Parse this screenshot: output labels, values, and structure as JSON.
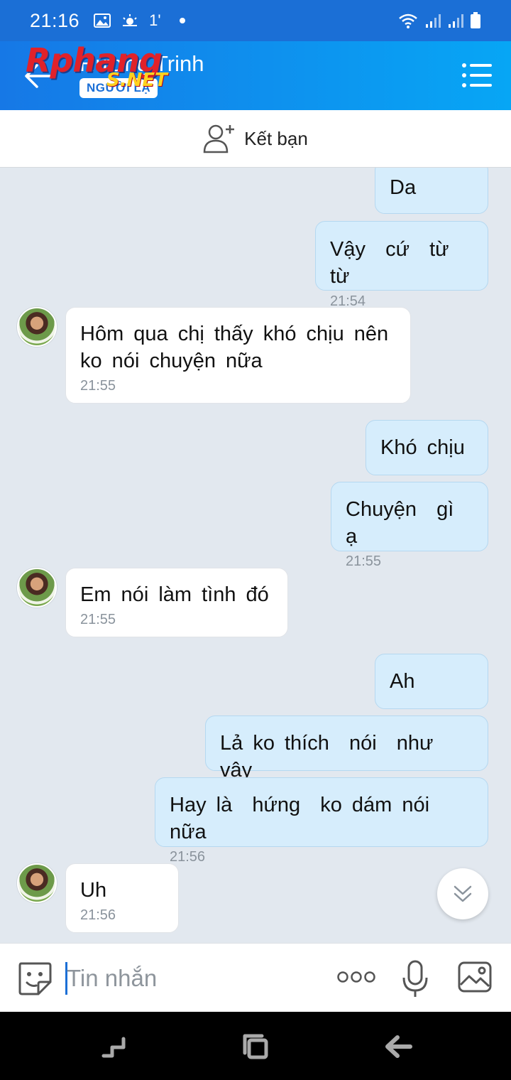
{
  "status_bar": {
    "time": "21:16",
    "temp": "1'"
  },
  "header": {
    "contact_name": "Hương Trinh",
    "badge": "NGƯỜI LẠ",
    "watermark": "Rphang",
    "watermark_suffix": "S.NET"
  },
  "friend_bar": {
    "label": "Kết bạn"
  },
  "messages": [
    {
      "side": "out",
      "text": "Da",
      "time": ""
    },
    {
      "side": "out",
      "text": "Vậy  cứ  từ  từ",
      "time": "21:54"
    },
    {
      "side": "in",
      "text": "Hôm qua chị thấy khó chịu nên\nko nói chuyện nữa",
      "time": "21:55"
    },
    {
      "side": "out",
      "text": "Khó chịu",
      "time": ""
    },
    {
      "side": "out",
      "text": "Chuyện  gì  ạ",
      "time": "21:55"
    },
    {
      "side": "in",
      "text": "Em nói làm tình đó",
      "time": "21:55"
    },
    {
      "side": "out",
      "text": "Ah",
      "time": ""
    },
    {
      "side": "out",
      "text": "Lả ko thích  nói  như  vậy",
      "time": ""
    },
    {
      "side": "out",
      "text": "Hay là  hứng  ko dám nói  nữa",
      "time": "21:56"
    },
    {
      "side": "in",
      "text": "Uh",
      "time": "21:56"
    }
  ],
  "input": {
    "placeholder": "Tin nhắn"
  },
  "icons": {
    "back": "arrow-left-icon",
    "menu": "list-menu-icon",
    "add_friend": "add-user-icon",
    "emoji": "sticker-face-icon",
    "more": "more-dots-icon",
    "mic": "microphone-icon",
    "image": "image-icon",
    "scroll": "chevron-double-down-icon"
  },
  "colors": {
    "accent": "#1b6fd6",
    "outgoing_bubble": "#d6edfc",
    "incoming_bubble": "#ffffff",
    "chat_bg": "#e2e8ef"
  }
}
